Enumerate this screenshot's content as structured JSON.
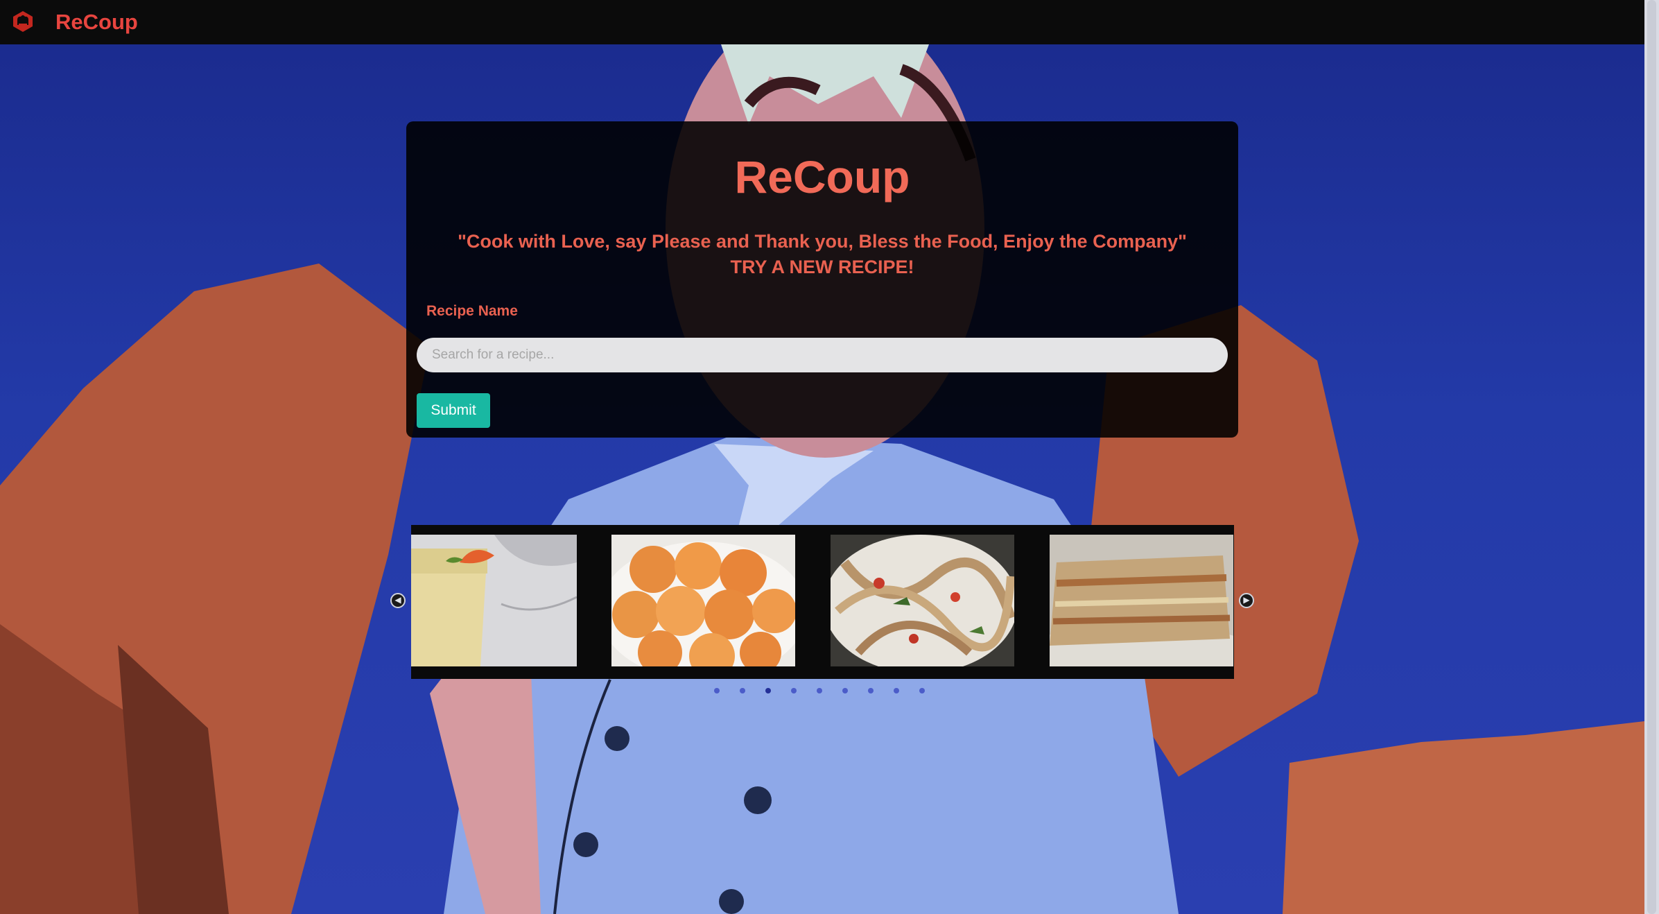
{
  "navbar": {
    "brand": "ReCoup",
    "logo_icon": "chef-hat-icon"
  },
  "hero": {
    "title": "ReCoup",
    "quote": "\"Cook with Love, say Please and Thank you, Bless the Food, Enjoy the Company\"",
    "tagline": "TRY A NEW RECIPE!",
    "field_label": "Recipe Name",
    "search_placeholder": "Search for a recipe...",
    "submit_label": "Submit"
  },
  "carousel": {
    "slides": [
      "smoothie-image",
      "sugar-donuts-image",
      "pasta-image",
      "lasagna-image"
    ],
    "prev_icon": "chevron-left-icon",
    "next_icon": "chevron-right-icon",
    "indicator_count": 9
  },
  "colors": {
    "accent": "#e8453f",
    "title": "#f16a58",
    "submit": "#19b8a2",
    "navbar": "#0b0b0b"
  }
}
